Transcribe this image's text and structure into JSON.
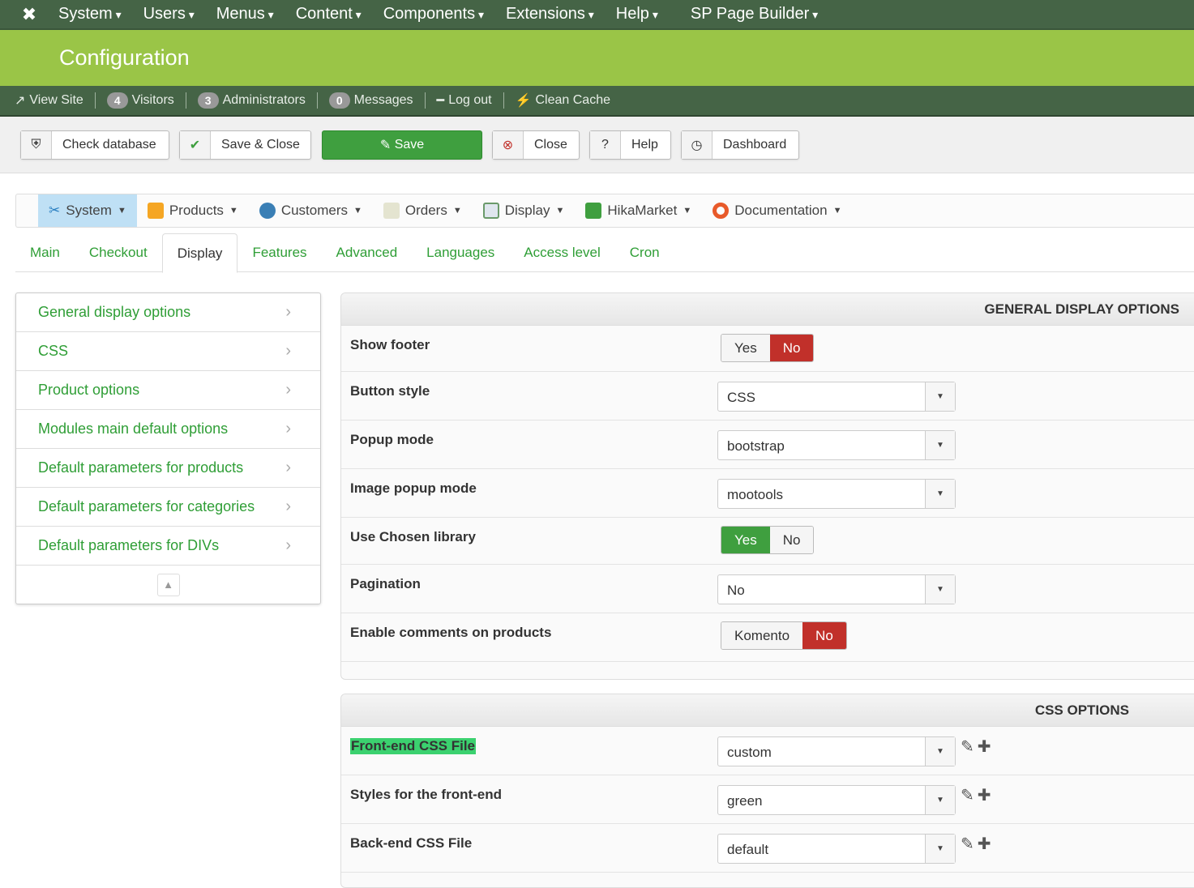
{
  "topnav": {
    "logo_icon": "joomla-logo-icon",
    "items": [
      "System",
      "Users",
      "Menus",
      "Content",
      "Components",
      "Extensions",
      "Help",
      "SP Page Builder"
    ]
  },
  "banner": {
    "title": "Configuration"
  },
  "statusbar": {
    "view_site": "View Site",
    "visitors_count": "4",
    "visitors": "Visitors",
    "admins_count": "3",
    "admins": "Administrators",
    "messages_count": "0",
    "messages": "Messages",
    "logout": "Log out",
    "clean_cache": "Clean Cache"
  },
  "toolbar": {
    "check_database": "Check database",
    "save_close": "Save & Close",
    "save": "Save",
    "close": "Close",
    "help": "Help",
    "dashboard": "Dashboard"
  },
  "hikamenu": {
    "items": [
      "System",
      "Products",
      "Customers",
      "Orders",
      "Display",
      "HikaMarket",
      "Documentation"
    ]
  },
  "tabs": [
    "Main",
    "Checkout",
    "Display",
    "Features",
    "Advanced",
    "Languages",
    "Access level",
    "Cron"
  ],
  "leftnav": [
    "General display options",
    "CSS",
    "Product options",
    "Modules main default options",
    "Default parameters for products",
    "Default parameters for categories",
    "Default parameters for DIVs"
  ],
  "general": {
    "title": "GENERAL DISPLAY OPTIONS",
    "rows": [
      {
        "label": "Show footer",
        "type": "toggle",
        "options": [
          "Yes",
          "No"
        ],
        "selected": "No"
      },
      {
        "label": "Button style",
        "type": "select",
        "value": "CSS"
      },
      {
        "label": "Popup mode",
        "type": "select",
        "value": "bootstrap"
      },
      {
        "label": "Image popup mode",
        "type": "select",
        "value": "mootools"
      },
      {
        "label": "Use Chosen library",
        "type": "toggle",
        "options": [
          "Yes",
          "No"
        ],
        "selected": "Yes"
      },
      {
        "label": "Pagination",
        "type": "select",
        "value": "No"
      },
      {
        "label": "Enable comments on products",
        "type": "toggle",
        "options": [
          "Komento",
          "No"
        ],
        "selected": "No"
      }
    ]
  },
  "css": {
    "title": "CSS OPTIONS",
    "rows": [
      {
        "label": "Front-end CSS File",
        "type": "select",
        "value": "custom",
        "highlight": true
      },
      {
        "label": "Styles for the front-end",
        "type": "select",
        "value": "green"
      },
      {
        "label": "Back-end CSS File",
        "type": "select",
        "value": "default"
      }
    ]
  }
}
